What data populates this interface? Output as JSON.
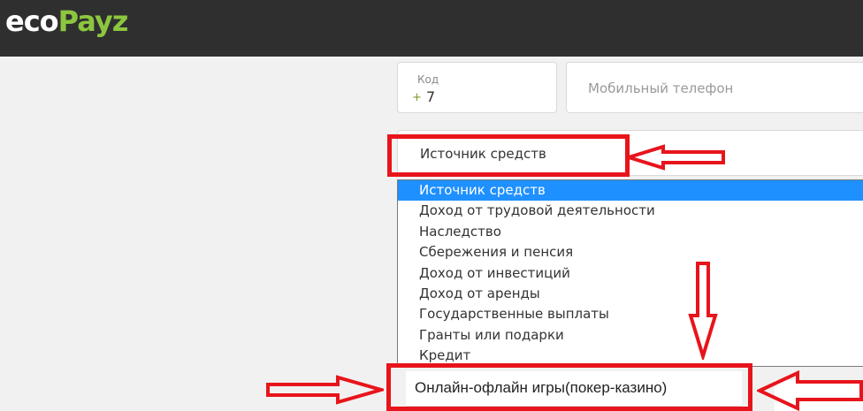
{
  "header": {
    "logo_eco": "eco",
    "logo_payz": "Payz"
  },
  "code_field": {
    "label": "Код",
    "plus": "+",
    "value": "7"
  },
  "phone_field": {
    "placeholder": "Мобильный телефон"
  },
  "source_select": {
    "selected": "Источник средств"
  },
  "dropdown": {
    "options": [
      "Источник средств",
      "Доход от трудовой деятельности",
      "Наследство",
      "Сбережения и пенсия",
      "Доход от инвестиций",
      "Доход от аренды",
      "Государственные выплаты",
      "Гранты или подарки",
      "Кредит"
    ]
  },
  "highlighted_option": "Онлайн-офлайн игры(покер-казино)",
  "colors": {
    "accent_green": "#8cc63f",
    "annotation_red": "#e8141b",
    "selection_blue": "#1e90ff",
    "header_bg": "#2f2f2f"
  }
}
